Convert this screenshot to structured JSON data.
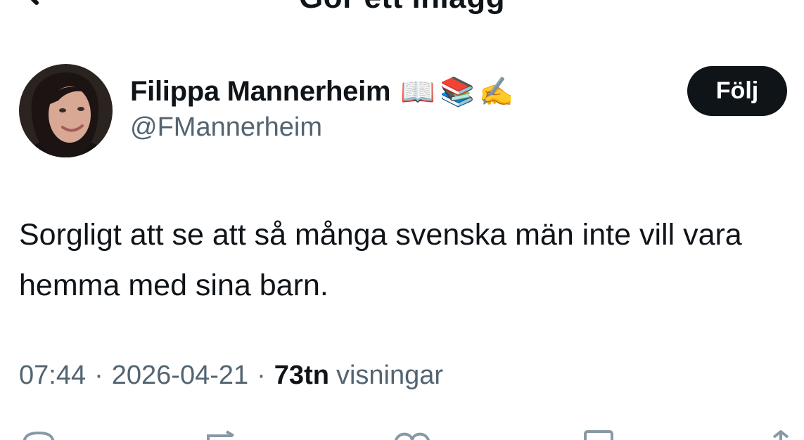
{
  "header": {
    "title": "Gör ett inlägg",
    "back_icon": "back-arrow-icon"
  },
  "author": {
    "name": "Filippa Mannerheim",
    "emoji": [
      "📖",
      "📚",
      "✍️"
    ],
    "handle": "@FMannerheim",
    "follow_label": "Följ"
  },
  "tweet": {
    "text": "Sorgligt att se att så många svenska män inte vill vara hemma med sina barn."
  },
  "meta": {
    "time": "07:44",
    "separator": "·",
    "date": "2026-04-21",
    "views_count": "73tn",
    "views_label": "visningar"
  },
  "actions": [
    "reply-icon",
    "repost-icon",
    "like-icon",
    "bookmark-icon",
    "share-icon"
  ]
}
